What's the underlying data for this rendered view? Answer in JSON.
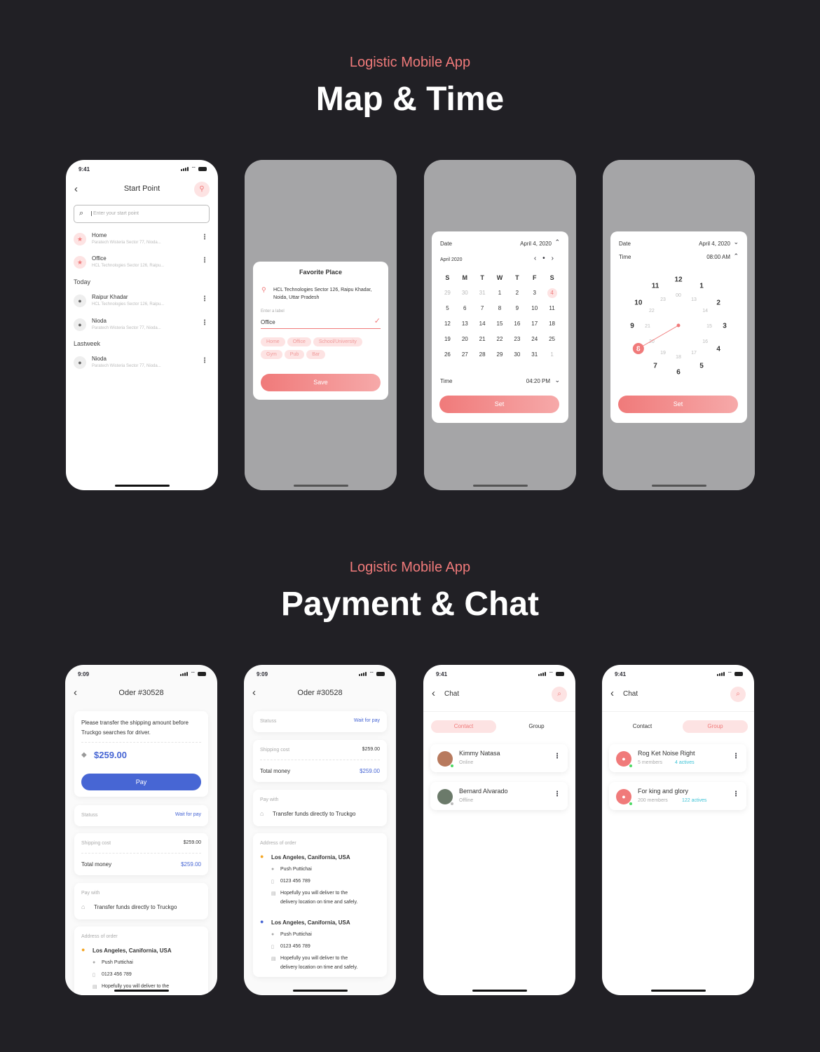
{
  "section1": {
    "subtitle": "Logistic Mobile App",
    "title": "Map & Time"
  },
  "section2": {
    "subtitle": "Logistic Mobile App",
    "title": "Payment & Chat"
  },
  "status_time": "9:41",
  "status_time_b": "9:09",
  "start_point": {
    "title": "Start Point",
    "search_placeholder": "Enter your start point",
    "saved": [
      {
        "name": "Home",
        "address": "Paratech Wisteria Sector 77, Nioda..."
      },
      {
        "name": "Office",
        "address": "HCL Technologies Sector 126, Raipu..."
      }
    ],
    "today_label": "Today",
    "today": [
      {
        "name": "Raipur Khadar",
        "address": "HCL Technologies Sector 126, Raipu..."
      },
      {
        "name": "Nioda",
        "address": "Paratech Wisteria Sector 77, Nioda..."
      }
    ],
    "lastweek_label": "Lastweek",
    "lastweek": [
      {
        "name": "Nioda",
        "address": "Paratech Wisteria Sector 77, Nioda..."
      }
    ]
  },
  "favorite": {
    "title": "Favorite Place",
    "address": "HCL Technologies Sector 126, Raipu Khadar, Noida, Uttar Pradesh",
    "input_label": "Enter a label",
    "input_value": "Office",
    "tags": [
      "Home",
      "Office",
      "School/University",
      "Gym",
      "Pub",
      "Bar"
    ],
    "save": "Save"
  },
  "calendar": {
    "date_label": "Date",
    "date_value": "April 4, 2020",
    "month": "April 2020",
    "weekdays": [
      "S",
      "M",
      "T",
      "W",
      "T",
      "F",
      "S"
    ],
    "days": [
      "29",
      "30",
      "31",
      "1",
      "2",
      "3",
      "4",
      "5",
      "6",
      "7",
      "8",
      "9",
      "10",
      "11",
      "12",
      "13",
      "14",
      "15",
      "16",
      "17",
      "18",
      "19",
      "20",
      "21",
      "22",
      "23",
      "24",
      "25",
      "26",
      "27",
      "28",
      "29",
      "30",
      "31",
      "1"
    ],
    "time_label": "Time",
    "time_value": "04:20 PM",
    "set": "Set"
  },
  "clock": {
    "date_label": "Date",
    "date_value": "April 4, 2020",
    "time_label": "Time",
    "time_value": "08:00 AM",
    "outer": [
      "12",
      "1",
      "2",
      "3",
      "4",
      "5",
      "6",
      "7",
      "8",
      "9",
      "10",
      "11"
    ],
    "inner": [
      "00",
      "13",
      "14",
      "15",
      "16",
      "17",
      "18",
      "19",
      "20",
      "21",
      "22",
      "23"
    ],
    "set": "Set"
  },
  "order": {
    "title": "Oder #30528",
    "transfer_note": "Please transfer the shipping amount before Truckgo searches for driver.",
    "amount": "$259.00",
    "pay": "Pay",
    "status_label": "Statuss",
    "status_value": "Wait for pay",
    "shipping_label": "Shipping cost",
    "shipping_value": "$259.00",
    "total_label": "Total money",
    "total_value": "$259.00",
    "pay_with_label": "Pay with",
    "pay_with_value": "Transfer funds directly to Truckgo",
    "address_label": "Address of order",
    "address_city": "Los Angeles, Canifornia, USA",
    "contact_name": "Push Puttichai",
    "contact_phone": "0123 456 789",
    "note": "Hopefully you will deliver to the",
    "note2": "delivery location on time and safely."
  },
  "chat": {
    "title": "Chat",
    "tab_contact": "Contact",
    "tab_group": "Group",
    "contacts": [
      {
        "name": "Kimmy Natasa",
        "status": "Online"
      },
      {
        "name": "Bernard Alvarado",
        "status": "Offline"
      }
    ],
    "groups": [
      {
        "name": "Rog Ket Noise Right",
        "members": "5 members",
        "actives": "4 actives"
      },
      {
        "name": "For king and glory",
        "members": "200 members",
        "actives": "122 actives"
      }
    ]
  },
  "colors": {
    "accent": "#f07a7a",
    "blue": "#4766d4",
    "background": "#212025"
  }
}
